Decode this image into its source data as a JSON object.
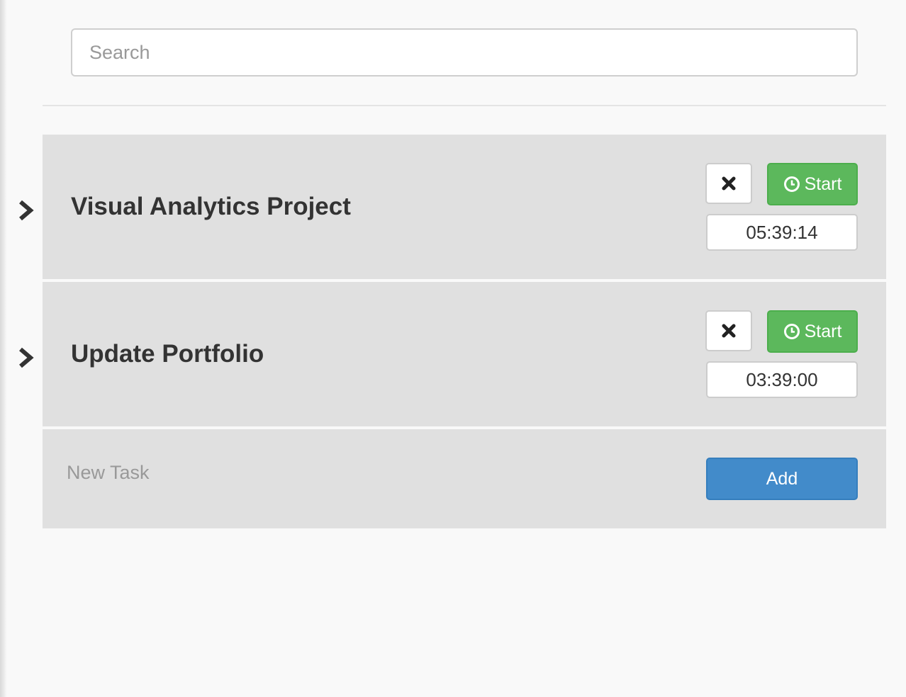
{
  "search": {
    "placeholder": "Search",
    "value": ""
  },
  "tasks": [
    {
      "title": "Visual Analytics Project",
      "start_label": "Start",
      "timer": "05:39:14"
    },
    {
      "title": "Update Portfolio",
      "start_label": "Start",
      "timer": "03:39:00"
    }
  ],
  "new_task": {
    "placeholder": "New Task",
    "value": "",
    "add_label": "Add"
  },
  "icons": {
    "expand": "chevron-right-icon",
    "delete": "close-icon",
    "start": "clock-icon"
  },
  "colors": {
    "start_button": "#5cb85c",
    "add_button": "#428bca",
    "row_background": "#e0e0e0",
    "page_background": "#f9f9f9"
  }
}
